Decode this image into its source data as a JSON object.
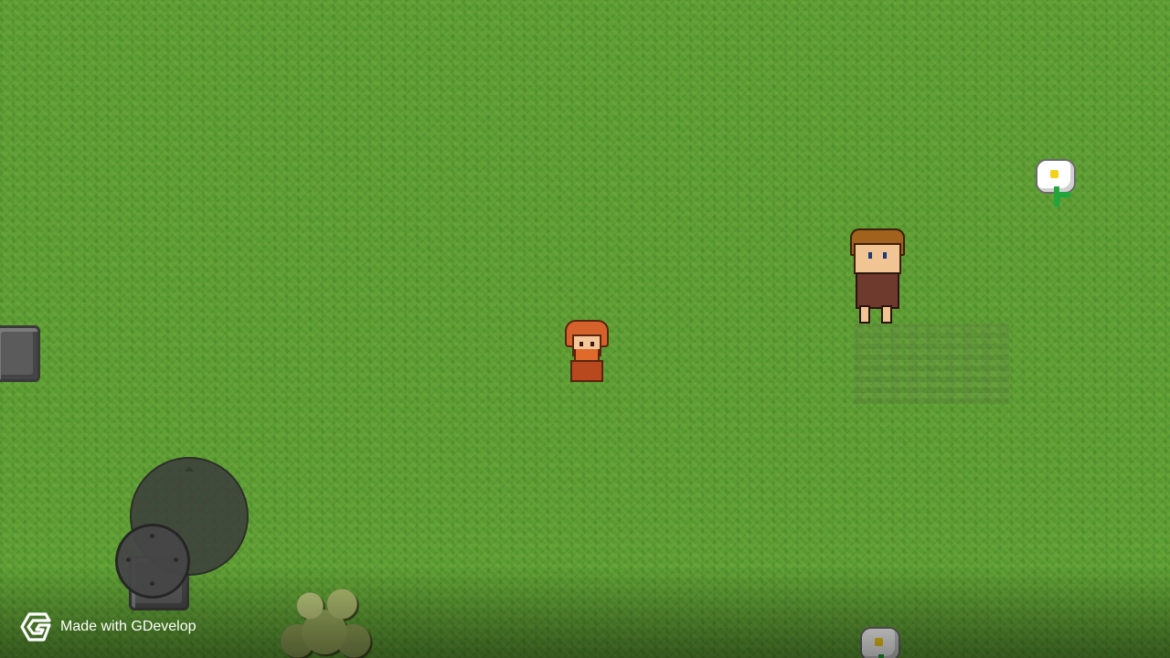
{
  "scene": {
    "background": "grass-field",
    "colors": {
      "grass": "#5a9a32",
      "rock": "#5b5b5b",
      "joystick": "#464646"
    }
  },
  "sprites": {
    "player": "player-character-sprite",
    "npc": "villager-npc-sprite",
    "flowers": [
      "white-flower-sprite",
      "white-flower-sprite"
    ],
    "rocks": [
      "rock-sprite",
      "rock-sprite"
    ],
    "bush": "bush-sprite"
  },
  "controls": {
    "joystick_base_icon": "joystick-base-icon",
    "joystick_thumb_icon": "joystick-thumb-icon"
  },
  "branding": {
    "logo_icon": "gdevelop-logo-icon",
    "text": "Made with GDevelop"
  }
}
